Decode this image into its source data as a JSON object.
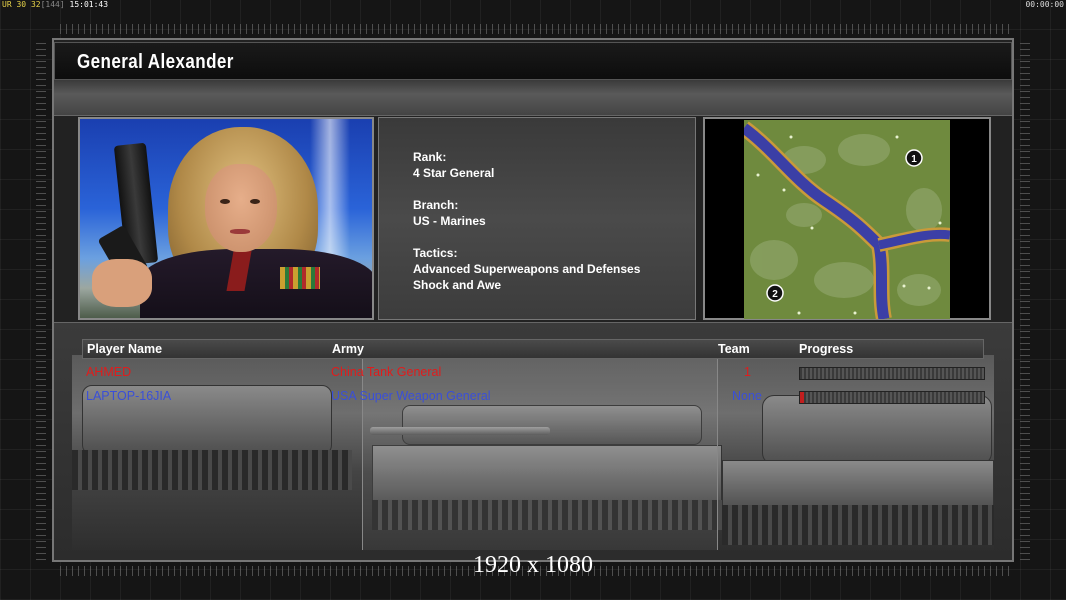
{
  "debug_bar": {
    "fps_label": "UR",
    "fps_a": "30",
    "fps_b": "32",
    "fps_c": "[144]",
    "clock": "15:01:43",
    "timer": "00:00:00"
  },
  "general": {
    "name": "General Alexander",
    "rank_label": "Rank:",
    "rank": "4 Star General",
    "branch_label": "Branch:",
    "branch": "US - Marines",
    "tactics_label": "Tactics:",
    "tactics_line1": "Advanced Superweapons and Defenses",
    "tactics_line2": "Shock and Awe"
  },
  "map": {
    "start_1": "1",
    "start_2": "2"
  },
  "players_table": {
    "headers": {
      "player_name": "Player Name",
      "army": "Army",
      "team": "Team",
      "progress": "Progress"
    },
    "rows": [
      {
        "name": "AHMED",
        "army": "China Tank General",
        "team": "1",
        "progress": 0.0,
        "color": "#e01c1c"
      },
      {
        "name": "LAPTOP-16JIA",
        "army": "USA Super Weapon General",
        "team": "None",
        "progress": 0.02,
        "color": "#3a4fd8"
      }
    ]
  },
  "resolution_label": "1920 x 1080"
}
